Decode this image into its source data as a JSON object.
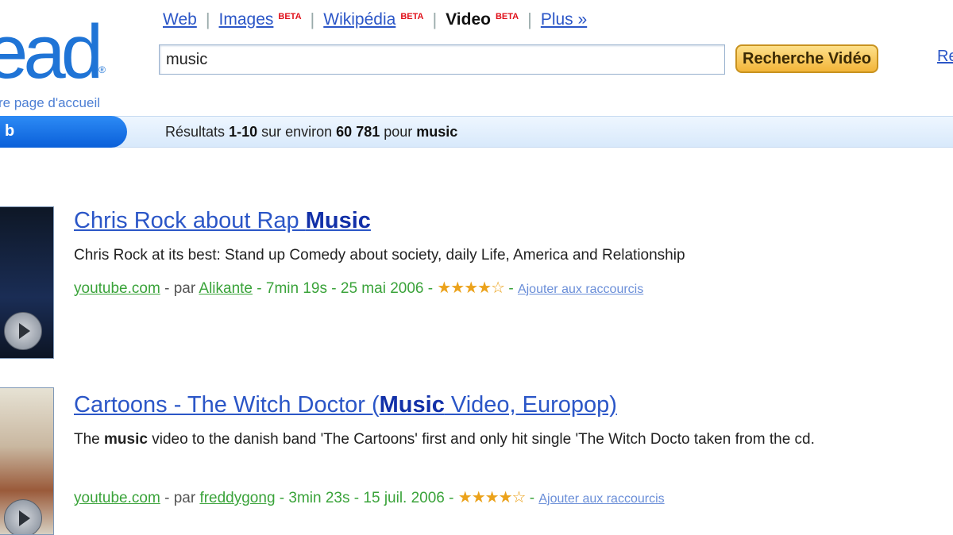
{
  "logo": {
    "text": "ead",
    "tm": "®",
    "home_link": "re page d'accueil"
  },
  "nav": {
    "items": [
      {
        "label": "Web",
        "beta": ""
      },
      {
        "label": "Images",
        "beta": "BETA"
      },
      {
        "label": "Wikipédia",
        "beta": "BETA"
      },
      {
        "label": "Video",
        "beta": "BETA"
      },
      {
        "label": "Plus »",
        "beta": ""
      }
    ]
  },
  "search": {
    "value": "music",
    "button": "Recherche Vidéo",
    "adv": "Re"
  },
  "tab": {
    "label": "b"
  },
  "results_bar": {
    "prefix": "Résultats",
    "range": "1-10",
    "mid": "sur environ",
    "total": "60 781",
    "pour": "pour",
    "query": "music"
  },
  "results": [
    {
      "title_pre": "Chris Rock about Rap ",
      "title_bold": "Music",
      "title_post": "",
      "desc_pre": "Chris Rock at its best: Stand up Comedy about society, daily Life, America and Relationship",
      "desc_bold": "",
      "desc_post": "",
      "site": "youtube.com",
      "by": "par",
      "author": "Alikante",
      "duration": "7min 19s",
      "date": "25 mai 2006",
      "rating": 4,
      "shortcut": "Ajouter aux raccourcis",
      "sep": "-"
    },
    {
      "title_pre": "Cartoons - The Witch Doctor (",
      "title_bold": "Music",
      "title_post": " Video, Europop)",
      "desc_pre": "The ",
      "desc_bold": "music",
      "desc_post": " video to the danish band 'The Cartoons' first and only hit single 'The Witch Docto taken from the cd.",
      "site": "youtube.com",
      "by": "par",
      "author": "freddygong",
      "duration": "3min 23s",
      "date": "15 juil. 2006",
      "rating": 4,
      "shortcut": "Ajouter aux raccourcis",
      "sep": "-"
    }
  ],
  "colors": {
    "accent": "#2b56c7",
    "tab": "#0a5fd9",
    "url_green": "#3aa33a",
    "star": "#eba21b",
    "beta": "#e0101a"
  },
  "icons": {
    "play": "play-icon",
    "star": "star-icon"
  }
}
